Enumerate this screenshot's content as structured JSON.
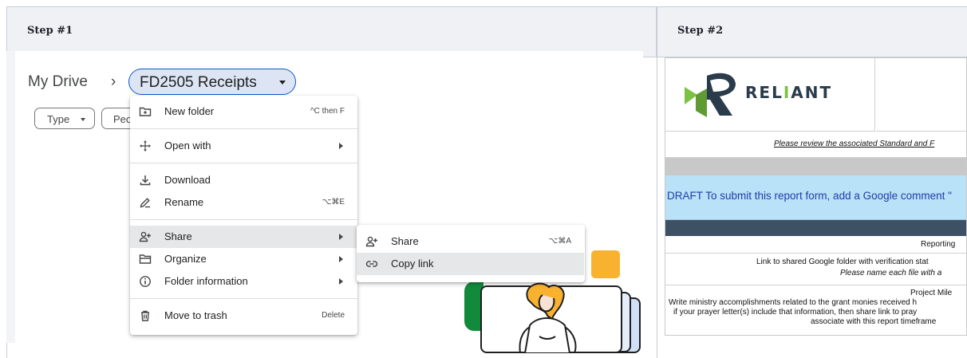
{
  "steps": {
    "step1_title": "Step #1",
    "step2_title": "Step #2"
  },
  "drive": {
    "breadcrumb_root": "My Drive",
    "breadcrumb_separator": "›",
    "current_folder": "FD2505 Receipts",
    "filters": {
      "type": "Type",
      "people": "Peo"
    }
  },
  "context_menu": {
    "items": [
      {
        "label": "New folder",
        "shortcut": "^C then F",
        "icon": "new-folder-icon"
      },
      {
        "label": "Open with",
        "icon": "open-with-icon",
        "submenu": true
      },
      {
        "label": "Download",
        "icon": "download-icon"
      },
      {
        "label": "Rename",
        "shortcut": "⌥⌘E",
        "icon": "rename-icon"
      },
      {
        "label": "Share",
        "icon": "share-icon",
        "submenu": true,
        "highlighted": true
      },
      {
        "label": "Organize",
        "icon": "organize-icon",
        "submenu": true
      },
      {
        "label": "Folder information",
        "icon": "info-icon",
        "submenu": true
      },
      {
        "label": "Move to trash",
        "shortcut": "Delete",
        "icon": "trash-icon"
      }
    ]
  },
  "share_submenu": {
    "items": [
      {
        "label": "Share",
        "shortcut": "⌥⌘A",
        "icon": "share-icon"
      },
      {
        "label": "Copy link",
        "icon": "link-icon",
        "highlighted": true
      }
    ]
  },
  "form": {
    "logo_text_a": "REL",
    "logo_text_i": "I",
    "logo_text_b": "ANT",
    "review_note": "Please review the associated Standard and F",
    "draft_notice": "DRAFT To submit this report form, add a Google comment \"",
    "reporting_label": "Reporting",
    "link_label": "Link to shared Google folder with verification stat",
    "name_file_note": "Please name each file with a",
    "project_label": "Project Mile",
    "project_line1": "Write ministry accomplishments related to the grant monies received h",
    "project_line2": "if your prayer letter(s) include that information, then share link to pray",
    "project_line3": "associate with this report timeframe"
  },
  "colors": {
    "header_bg": "#eff1f5",
    "pill_border": "#0b57d0",
    "pill_bg": "#dde5f5",
    "menu_highlight": "#e6e7e9",
    "draft_bg": "#b9e1f7",
    "draft_text": "#1e3fa8",
    "dark_band": "#3d5064",
    "logo_green": "#7cc242",
    "logo_navy": "#2a3b4c"
  }
}
